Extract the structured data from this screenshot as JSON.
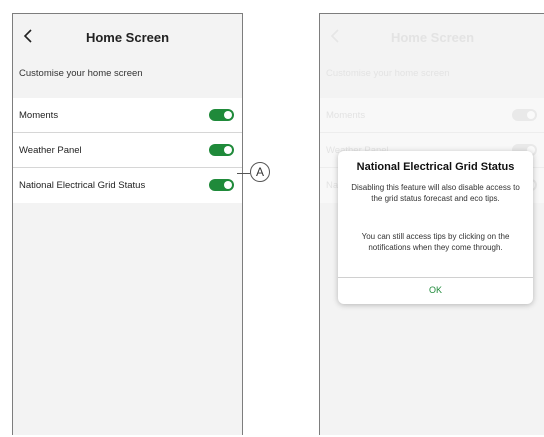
{
  "screen": {
    "title": "Home Screen",
    "subtitle": "Customise your home screen",
    "items": [
      {
        "label": "Moments",
        "enabled": true
      },
      {
        "label": "Weather Panel",
        "enabled": true
      },
      {
        "label": "National Electrical Grid Status",
        "enabled": true
      }
    ]
  },
  "callout": {
    "label": "A"
  },
  "dialog": {
    "title": "National Electrical Grid Status",
    "paragraph1": "Disabling this feature will also disable access to the grid status forecast and eco tips.",
    "paragraph2": "You can still access tips by clicking on the notifications when they come through.",
    "ok_label": "OK"
  },
  "colors": {
    "accent": "#1f8a3a",
    "background": "#f3f3f3",
    "list_background": "#ffffff"
  },
  "icons": {
    "back": "chevron-left-icon"
  }
}
